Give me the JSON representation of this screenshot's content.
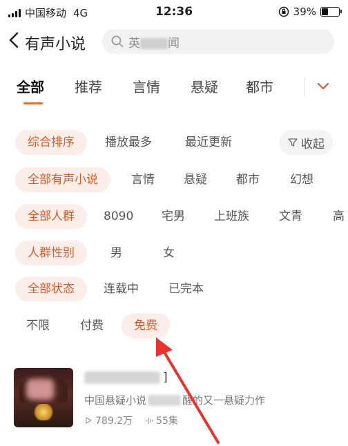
{
  "status": {
    "carrier": "中国移动",
    "network": "4G",
    "time": "12:36",
    "battery_text": "39%",
    "battery_level": 0.39
  },
  "header": {
    "title": "有声小说",
    "search_placeholder_start": "英",
    "search_placeholder_end": "闻"
  },
  "tabs": [
    {
      "label": "全部",
      "active": true
    },
    {
      "label": "推荐"
    },
    {
      "label": "言情"
    },
    {
      "label": "悬疑"
    },
    {
      "label": "都市"
    }
  ],
  "filters": {
    "sort": {
      "items": [
        "综合排序",
        "播放最多",
        "最近更新"
      ],
      "collapse_label": "收起"
    },
    "category": {
      "items": [
        "全部有声小说",
        "言情",
        "悬疑",
        "都市",
        "幻想"
      ]
    },
    "audience": {
      "items": [
        "全部人群",
        "8090",
        "宅男",
        "上班族",
        "文青",
        "高"
      ]
    },
    "gender": {
      "items": [
        "人群性别",
        "男",
        "女"
      ]
    },
    "status": {
      "items": [
        "全部状态",
        "连载中",
        "已完本"
      ]
    },
    "price": {
      "items": [
        "不限",
        "付费",
        "免费"
      ]
    }
  },
  "book": {
    "title_suffix": "]",
    "desc_start": "中国悬疑小说",
    "desc_end": "醒的又一悬疑力作",
    "plays": "789.2万",
    "episodes": "55集"
  },
  "colors": {
    "accent": "#e25a2a",
    "chip_bg": "#fbeee8",
    "arrow": "#e8332e"
  }
}
